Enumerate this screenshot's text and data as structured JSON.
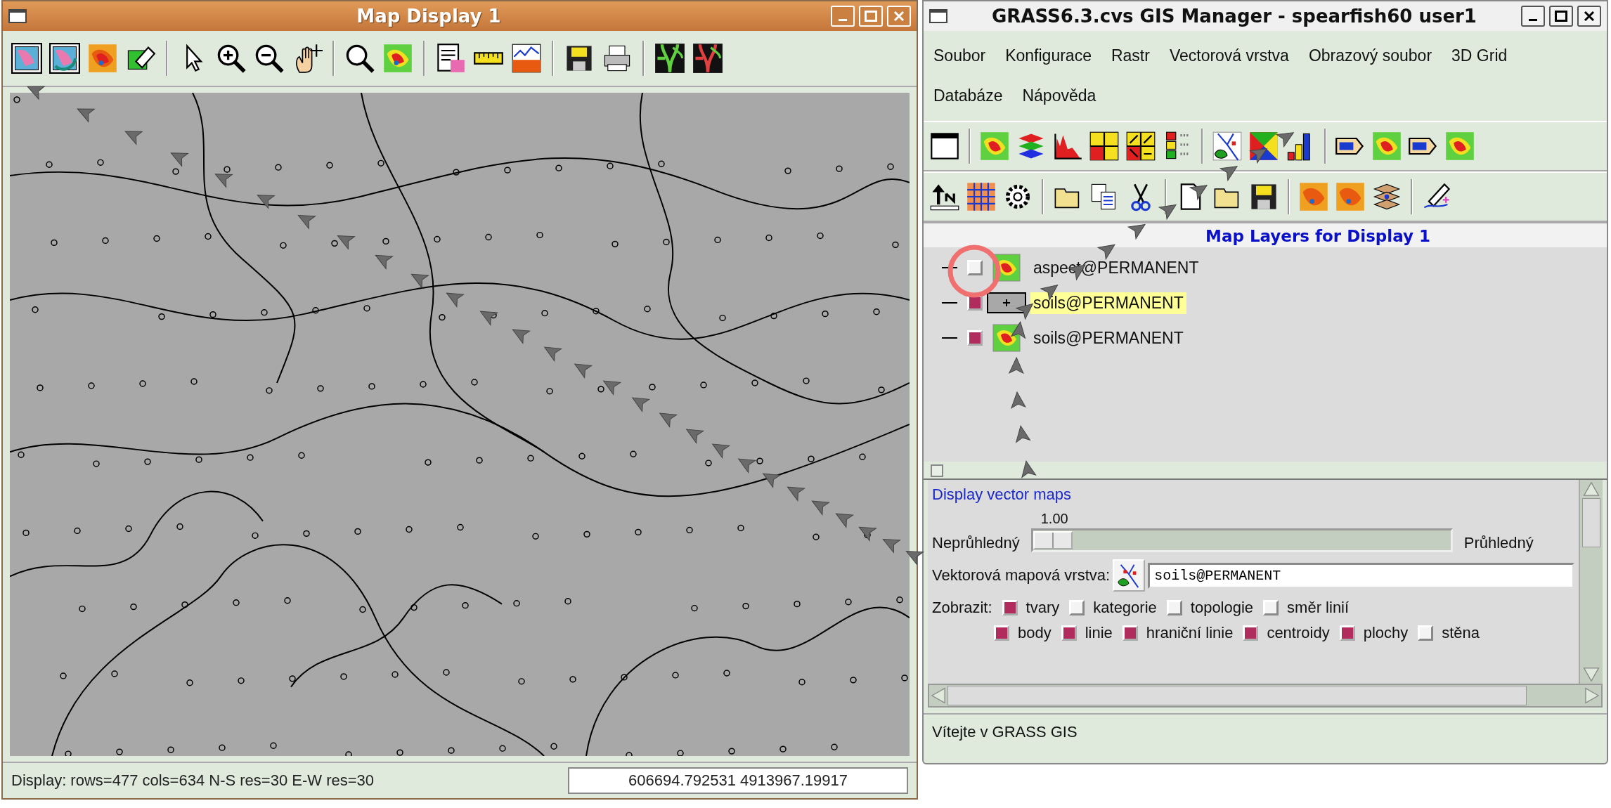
{
  "map_display": {
    "title": "Map Display 1",
    "status": "Display: rows=477 cols=634 N-S res=30 E-W res=30",
    "coordinates": "606694.792531 4913967.19917"
  },
  "gis_manager": {
    "title": "GRASS6.3.cvs GIS Manager - spearfish60 user1",
    "menus": [
      "Soubor",
      "Konfigurace",
      "Rastr",
      "Vectorová vrstva",
      "Obrazový soubor",
      "3D Grid",
      "Databáze",
      "Nápověda"
    ],
    "layer_tree": {
      "header": "Map Layers for Display 1",
      "layers": [
        {
          "name": "aspect@PERMANENT",
          "kind": "raster",
          "checked": false,
          "selected": false
        },
        {
          "name": "soils@PERMANENT",
          "kind": "vector",
          "checked": true,
          "selected": true
        },
        {
          "name": "soils@PERMANENT",
          "kind": "raster",
          "checked": true,
          "selected": false
        }
      ]
    },
    "properties": {
      "title": "Display vector maps",
      "opacity": {
        "label_left": "Neprůhledný",
        "label_right": "Průhledný",
        "reading": "1.00",
        "level": 0
      },
      "vector_map": {
        "label": "Vektorová mapová vrstva:",
        "value": "soils@PERMANENT"
      },
      "display": {
        "label": "Zobrazit:",
        "option_rows": [
          {
            "options": [
              {
                "label": "tvary",
                "checked": true
              },
              {
                "label": "kategorie",
                "checked": false
              },
              {
                "label": "topologie",
                "checked": false
              },
              {
                "label": "směr linií",
                "checked": false
              }
            ]
          },
          {
            "options": [
              {
                "label": "body",
                "checked": true
              },
              {
                "label": "linie",
                "checked": true
              },
              {
                "label": "hraniční linie",
                "checked": true
              },
              {
                "label": "centroidy",
                "checked": true
              },
              {
                "label": "plochy",
                "checked": true
              },
              {
                "label": "stěna",
                "checked": false
              }
            ]
          }
        ]
      }
    },
    "status_bar": "Vítejte v GRASS GIS"
  }
}
